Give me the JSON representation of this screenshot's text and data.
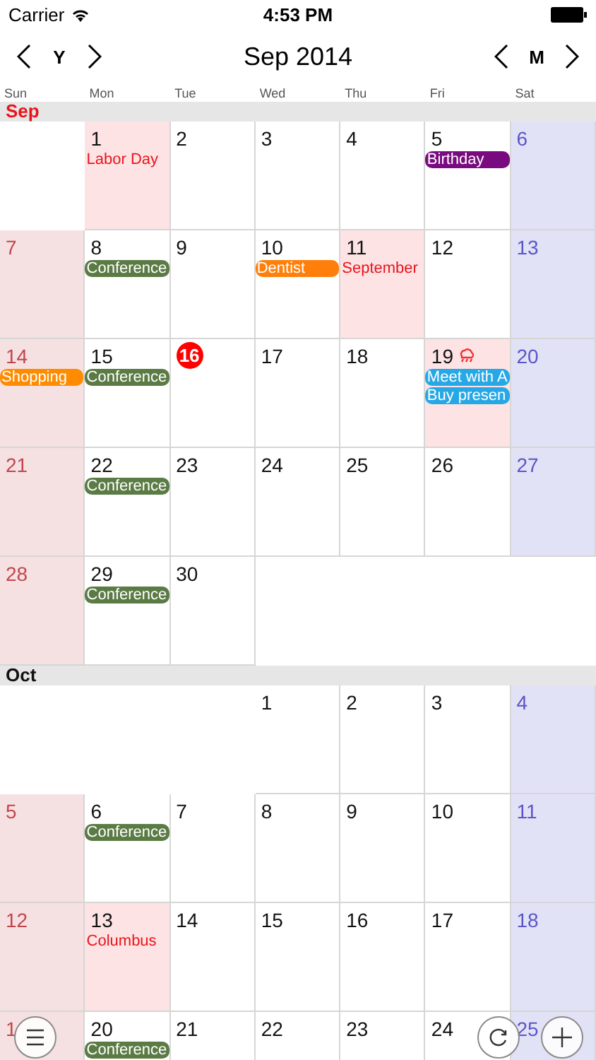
{
  "status_bar": {
    "carrier": "Carrier",
    "time": "4:53 PM"
  },
  "nav": {
    "year_key": "Y",
    "title": "Sep 2014",
    "month_key": "M"
  },
  "weekdays": [
    "Sun",
    "Mon",
    "Tue",
    "Wed",
    "Thu",
    "Fri",
    "Sat"
  ],
  "months": [
    {
      "name": "Sep",
      "current": true,
      "weeks": [
        [
          {
            "kind": "blank"
          },
          {
            "day": "1",
            "holiday": true,
            "events": [
              {
                "kind": "text",
                "title": "Labor Day"
              }
            ]
          },
          {
            "day": "2"
          },
          {
            "day": "3"
          },
          {
            "day": "4"
          },
          {
            "day": "5",
            "events": [
              {
                "kind": "bar",
                "title": "Birthday",
                "color": "#7a0a80"
              }
            ]
          },
          {
            "day": "6"
          }
        ],
        [
          {
            "day": "7"
          },
          {
            "day": "8",
            "events": [
              {
                "kind": "bar",
                "title": "Conference",
                "color": "#5b7b45"
              }
            ]
          },
          {
            "day": "9"
          },
          {
            "day": "10",
            "events": [
              {
                "kind": "bar",
                "title": "Dentist",
                "color": "#ff7f0a"
              }
            ]
          },
          {
            "day": "11",
            "holiday": true,
            "events": [
              {
                "kind": "text",
                "title": "September"
              }
            ]
          },
          {
            "day": "12"
          },
          {
            "day": "13"
          }
        ],
        [
          {
            "day": "14",
            "events": [
              {
                "kind": "bar",
                "title": "Shopping",
                "color": "#ff8c00"
              }
            ]
          },
          {
            "day": "15",
            "events": [
              {
                "kind": "bar",
                "title": "Conference",
                "color": "#5b7b45"
              }
            ]
          },
          {
            "day": "16",
            "today": true
          },
          {
            "day": "17"
          },
          {
            "day": "18"
          },
          {
            "day": "19",
            "holiday": true,
            "weather_icon": true,
            "events": [
              {
                "kind": "bar",
                "title": "Meet with A",
                "color": "#27a8e6"
              },
              {
                "kind": "bar",
                "title": "Buy presen",
                "color": "#27a8e6"
              }
            ]
          },
          {
            "day": "20"
          }
        ],
        [
          {
            "day": "21"
          },
          {
            "day": "22",
            "events": [
              {
                "kind": "bar",
                "title": "Conference",
                "color": "#5b7b45"
              }
            ]
          },
          {
            "day": "23"
          },
          {
            "day": "24"
          },
          {
            "day": "25"
          },
          {
            "day": "26"
          },
          {
            "day": "27"
          }
        ],
        [
          {
            "day": "28"
          },
          {
            "day": "29",
            "events": [
              {
                "kind": "bar",
                "title": "Conference",
                "color": "#5b7b45"
              }
            ]
          },
          {
            "day": "30"
          },
          {
            "kind": "blank"
          },
          {
            "kind": "blank"
          },
          {
            "kind": "blank"
          },
          {
            "kind": "blank"
          }
        ]
      ]
    },
    {
      "name": "Oct",
      "current": false,
      "weeks": [
        [
          {
            "kind": "blank"
          },
          {
            "kind": "blank"
          },
          {
            "kind": "blank"
          },
          {
            "day": "1"
          },
          {
            "day": "2"
          },
          {
            "day": "3"
          },
          {
            "day": "4"
          }
        ],
        [
          {
            "day": "5"
          },
          {
            "day": "6",
            "events": [
              {
                "kind": "bar",
                "title": "Conference",
                "color": "#5b7b45"
              }
            ]
          },
          {
            "day": "7"
          },
          {
            "day": "8"
          },
          {
            "day": "9"
          },
          {
            "day": "10"
          },
          {
            "day": "11"
          }
        ],
        [
          {
            "day": "12"
          },
          {
            "day": "13",
            "holiday": true,
            "events": [
              {
                "kind": "text",
                "title": "Columbus"
              }
            ]
          },
          {
            "day": "14"
          },
          {
            "day": "15"
          },
          {
            "day": "16"
          },
          {
            "day": "17"
          },
          {
            "day": "18"
          }
        ],
        [
          {
            "day": "1"
          },
          {
            "day": "20",
            "events": [
              {
                "kind": "bar",
                "title": "Conference",
                "color": "#5b7b45"
              }
            ]
          },
          {
            "day": "21"
          },
          {
            "day": "22"
          },
          {
            "day": "23"
          },
          {
            "day": "24"
          },
          {
            "day": "25"
          }
        ]
      ]
    }
  ]
}
